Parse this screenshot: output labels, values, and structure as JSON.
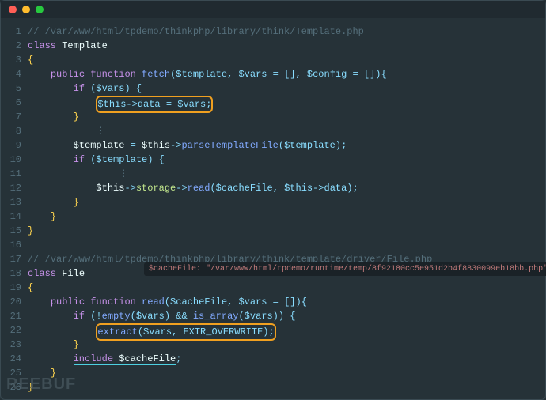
{
  "window": {
    "title": ""
  },
  "lines": [
    {
      "n": 1
    },
    {
      "n": 2
    },
    {
      "n": 3
    },
    {
      "n": 4
    },
    {
      "n": 5
    },
    {
      "n": 6
    },
    {
      "n": 7
    },
    {
      "n": 8
    },
    {
      "n": 9
    },
    {
      "n": 10
    },
    {
      "n": 11
    },
    {
      "n": 12
    },
    {
      "n": 13
    },
    {
      "n": 14
    },
    {
      "n": 15
    },
    {
      "n": 16
    },
    {
      "n": 17
    },
    {
      "n": 18
    },
    {
      "n": 19
    },
    {
      "n": 20
    },
    {
      "n": 21
    },
    {
      "n": 22
    },
    {
      "n": 23
    },
    {
      "n": 24
    },
    {
      "n": 25
    },
    {
      "n": 26
    }
  ],
  "code": {
    "l1": "// /var/www/html/tpdemo/thinkphp/library/think/Template.php",
    "l2_class": "class",
    "l2_name": "Template",
    "l3_brace": "{",
    "l4_pub": "public",
    "l4_func": "function",
    "l4_name": "fetch",
    "l4_params": "($template, $vars = [], $config = []){",
    "l5_if": "if",
    "l5_cond": " ($vars) {",
    "l6_box": "$this->data = $vars;",
    "l7": "}",
    "l8": "⋮",
    "l9_var1": "$template",
    "l9_eq": " = ",
    "l9_this": "$this",
    "l9_arrow": "->",
    "l9_fn": "parseTemplateFile",
    "l9_end": "($template);",
    "l10_if": "if",
    "l10_cond": " ($template) {",
    "l11": "⋮",
    "l12_this": "$this",
    "l12_arrow": "->",
    "l12_prop": "storage",
    "l12_arrow2": "->",
    "l12_fn": "read",
    "l12_args": "($cacheFile, $this->data);",
    "l13": "}",
    "l14": "}",
    "l15": "}",
    "l16": "",
    "l17": "// /var/www/html/tpdemo/thinkphp/library/think/template/driver/File.php",
    "l18_class": "class",
    "l18_name": "File",
    "l19": "{",
    "l20_pub": "public",
    "l20_func": "function",
    "l20_name": "read",
    "l20_params": "($cacheFile, $vars = []){",
    "l21_if": "if",
    "l21_a": " (!",
    "l21_empty": "empty",
    "l21_b": "($vars) && ",
    "l21_isarr": "is_array",
    "l21_c": "($vars)) {",
    "l22_boxa": "extract",
    "l22_boxb": "($vars, EXTR_OVERWRITE);",
    "l23": "}",
    "l24_inc": "include",
    "l24_var": " $cacheFile",
    "l24_end": ";",
    "l25": "}",
    "l26": "}"
  },
  "tooltip": "$cacheFile: \"/var/www/html/tpdemo/runtime/temp/8f92180cc5e951d2b4f8830099eb18bb.php\"",
  "watermark": "REEBUF"
}
